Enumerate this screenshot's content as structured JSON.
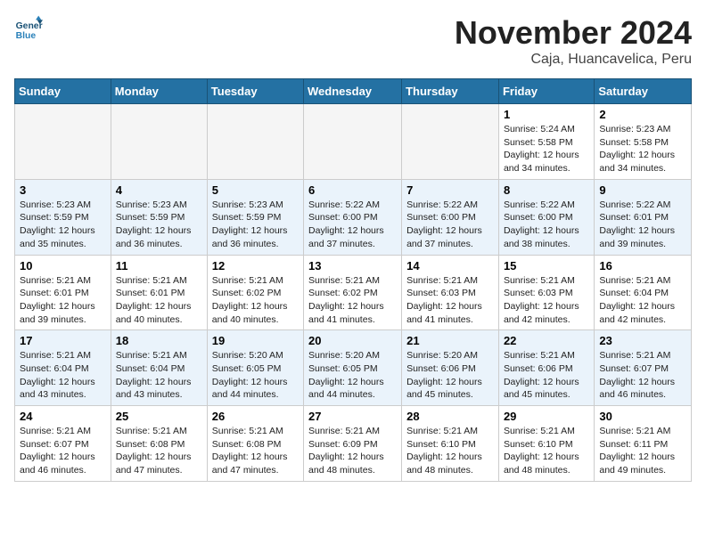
{
  "header": {
    "logo_line1": "General",
    "logo_line2": "Blue",
    "month": "November 2024",
    "location": "Caja, Huancavelica, Peru"
  },
  "weekdays": [
    "Sunday",
    "Monday",
    "Tuesday",
    "Wednesday",
    "Thursday",
    "Friday",
    "Saturday"
  ],
  "weeks": [
    [
      {
        "day": "",
        "info": ""
      },
      {
        "day": "",
        "info": ""
      },
      {
        "day": "",
        "info": ""
      },
      {
        "day": "",
        "info": ""
      },
      {
        "day": "",
        "info": ""
      },
      {
        "day": "1",
        "info": "Sunrise: 5:24 AM\nSunset: 5:58 PM\nDaylight: 12 hours\nand 34 minutes."
      },
      {
        "day": "2",
        "info": "Sunrise: 5:23 AM\nSunset: 5:58 PM\nDaylight: 12 hours\nand 34 minutes."
      }
    ],
    [
      {
        "day": "3",
        "info": "Sunrise: 5:23 AM\nSunset: 5:59 PM\nDaylight: 12 hours\nand 35 minutes."
      },
      {
        "day": "4",
        "info": "Sunrise: 5:23 AM\nSunset: 5:59 PM\nDaylight: 12 hours\nand 36 minutes."
      },
      {
        "day": "5",
        "info": "Sunrise: 5:23 AM\nSunset: 5:59 PM\nDaylight: 12 hours\nand 36 minutes."
      },
      {
        "day": "6",
        "info": "Sunrise: 5:22 AM\nSunset: 6:00 PM\nDaylight: 12 hours\nand 37 minutes."
      },
      {
        "day": "7",
        "info": "Sunrise: 5:22 AM\nSunset: 6:00 PM\nDaylight: 12 hours\nand 37 minutes."
      },
      {
        "day": "8",
        "info": "Sunrise: 5:22 AM\nSunset: 6:00 PM\nDaylight: 12 hours\nand 38 minutes."
      },
      {
        "day": "9",
        "info": "Sunrise: 5:22 AM\nSunset: 6:01 PM\nDaylight: 12 hours\nand 39 minutes."
      }
    ],
    [
      {
        "day": "10",
        "info": "Sunrise: 5:21 AM\nSunset: 6:01 PM\nDaylight: 12 hours\nand 39 minutes."
      },
      {
        "day": "11",
        "info": "Sunrise: 5:21 AM\nSunset: 6:01 PM\nDaylight: 12 hours\nand 40 minutes."
      },
      {
        "day": "12",
        "info": "Sunrise: 5:21 AM\nSunset: 6:02 PM\nDaylight: 12 hours\nand 40 minutes."
      },
      {
        "day": "13",
        "info": "Sunrise: 5:21 AM\nSunset: 6:02 PM\nDaylight: 12 hours\nand 41 minutes."
      },
      {
        "day": "14",
        "info": "Sunrise: 5:21 AM\nSunset: 6:03 PM\nDaylight: 12 hours\nand 41 minutes."
      },
      {
        "day": "15",
        "info": "Sunrise: 5:21 AM\nSunset: 6:03 PM\nDaylight: 12 hours\nand 42 minutes."
      },
      {
        "day": "16",
        "info": "Sunrise: 5:21 AM\nSunset: 6:04 PM\nDaylight: 12 hours\nand 42 minutes."
      }
    ],
    [
      {
        "day": "17",
        "info": "Sunrise: 5:21 AM\nSunset: 6:04 PM\nDaylight: 12 hours\nand 43 minutes."
      },
      {
        "day": "18",
        "info": "Sunrise: 5:21 AM\nSunset: 6:04 PM\nDaylight: 12 hours\nand 43 minutes."
      },
      {
        "day": "19",
        "info": "Sunrise: 5:20 AM\nSunset: 6:05 PM\nDaylight: 12 hours\nand 44 minutes."
      },
      {
        "day": "20",
        "info": "Sunrise: 5:20 AM\nSunset: 6:05 PM\nDaylight: 12 hours\nand 44 minutes."
      },
      {
        "day": "21",
        "info": "Sunrise: 5:20 AM\nSunset: 6:06 PM\nDaylight: 12 hours\nand 45 minutes."
      },
      {
        "day": "22",
        "info": "Sunrise: 5:21 AM\nSunset: 6:06 PM\nDaylight: 12 hours\nand 45 minutes."
      },
      {
        "day": "23",
        "info": "Sunrise: 5:21 AM\nSunset: 6:07 PM\nDaylight: 12 hours\nand 46 minutes."
      }
    ],
    [
      {
        "day": "24",
        "info": "Sunrise: 5:21 AM\nSunset: 6:07 PM\nDaylight: 12 hours\nand 46 minutes."
      },
      {
        "day": "25",
        "info": "Sunrise: 5:21 AM\nSunset: 6:08 PM\nDaylight: 12 hours\nand 47 minutes."
      },
      {
        "day": "26",
        "info": "Sunrise: 5:21 AM\nSunset: 6:08 PM\nDaylight: 12 hours\nand 47 minutes."
      },
      {
        "day": "27",
        "info": "Sunrise: 5:21 AM\nSunset: 6:09 PM\nDaylight: 12 hours\nand 48 minutes."
      },
      {
        "day": "28",
        "info": "Sunrise: 5:21 AM\nSunset: 6:10 PM\nDaylight: 12 hours\nand 48 minutes."
      },
      {
        "day": "29",
        "info": "Sunrise: 5:21 AM\nSunset: 6:10 PM\nDaylight: 12 hours\nand 48 minutes."
      },
      {
        "day": "30",
        "info": "Sunrise: 5:21 AM\nSunset: 6:11 PM\nDaylight: 12 hours\nand 49 minutes."
      }
    ]
  ]
}
